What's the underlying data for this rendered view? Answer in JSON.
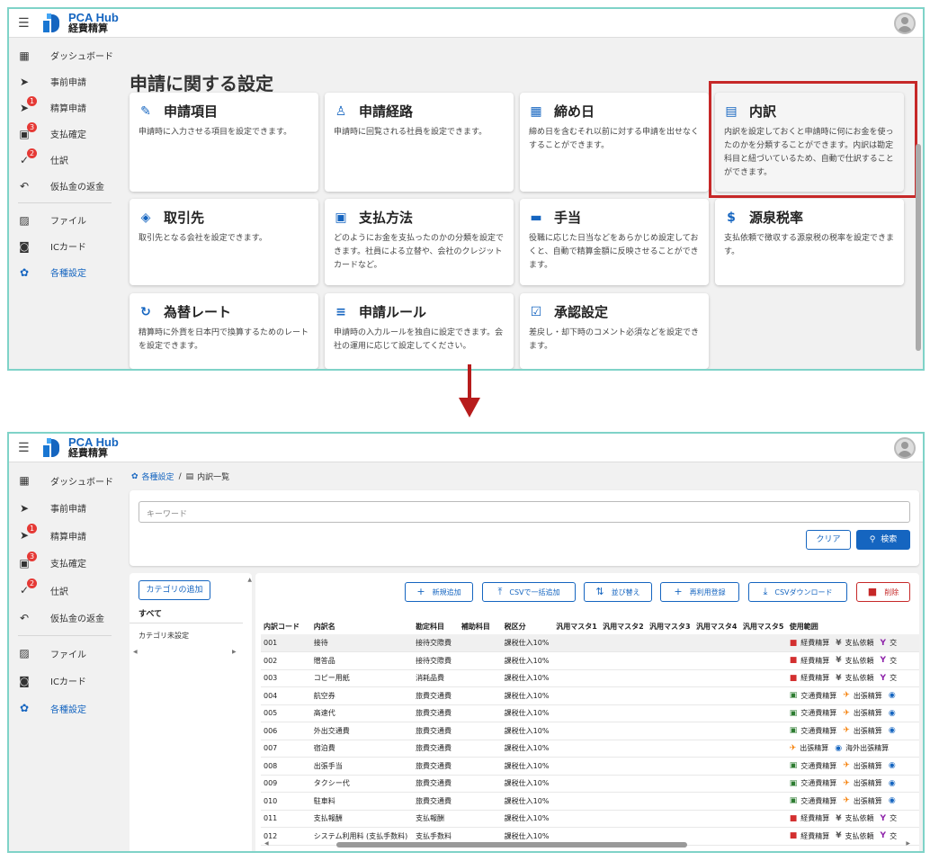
{
  "app": {
    "brand": "PCA Hub",
    "subtitle": "経費精算",
    "menu_icon": "☰"
  },
  "sidebar": {
    "items": [
      {
        "label": "ダッシュボード",
        "icon": "dashboard-icon",
        "glyph": "▦",
        "badge": ""
      },
      {
        "label": "事前申請",
        "icon": "send-clock-icon",
        "glyph": "➤",
        "badge": ""
      },
      {
        "label": "精算申請",
        "icon": "send-icon",
        "glyph": "➤",
        "badge": "1"
      },
      {
        "label": "支払確定",
        "icon": "payment-icon",
        "glyph": "▣",
        "badge": "3"
      },
      {
        "label": "仕訳",
        "icon": "check-icon",
        "glyph": "✓",
        "badge": "2"
      },
      {
        "label": "仮払金の返金",
        "icon": "undo-icon",
        "glyph": "↶",
        "badge": ""
      },
      {
        "label": "ファイル",
        "icon": "image-icon",
        "glyph": "▨",
        "badge": ""
      },
      {
        "label": "ICカード",
        "icon": "card-icon",
        "glyph": "◙",
        "badge": ""
      },
      {
        "label": "各種設定",
        "icon": "gear-icon",
        "glyph": "✿",
        "badge": ""
      }
    ]
  },
  "settings": {
    "title": "申請に関する設定",
    "cards": [
      {
        "title": "申請項目",
        "desc": "申請時に入力させる項目を設定できます。",
        "icon": "pencil-icon",
        "glyph": "✎"
      },
      {
        "title": "申請経路",
        "desc": "申請時に回覧される社員を設定できます。",
        "icon": "person-route-icon",
        "glyph": "♙"
      },
      {
        "title": "締め日",
        "desc": "締め日を含むそれ以前に対する申請を出せなくすることができます。",
        "icon": "calendar-icon",
        "glyph": "▦"
      },
      {
        "title": "内訳",
        "desc": "内訳を設定しておくと申請時に何にお金を使ったのかを分類することができます。内訳は勘定科目と紐づいているため、自動で仕訳することができます。",
        "icon": "receipt-icon",
        "glyph": "▤"
      },
      {
        "title": "取引先",
        "desc": "取引先となる会社を設定できます。",
        "icon": "handshake-icon",
        "glyph": "◈"
      },
      {
        "title": "支払方法",
        "desc": "どのようにお金を支払ったのかの分類を設定できます。社員による立替や、会社のクレジットカードなど。",
        "icon": "payment-method-icon",
        "glyph": "▣"
      },
      {
        "title": "手当",
        "desc": "役職に応じた日当などをあらかじめ設定しておくと、自動で精算金額に反映させることができます。",
        "icon": "bed-icon",
        "glyph": "▬"
      },
      {
        "title": "源泉税率",
        "desc": "支払依頼で徴収する源泉税の税率を設定できます。",
        "icon": "dollar-icon",
        "glyph": "$"
      },
      {
        "title": "為替レート",
        "desc": "精算時に外貨を日本円で換算するためのレートを設定できます。",
        "icon": "exchange-icon",
        "glyph": "↻"
      },
      {
        "title": "申請ルール",
        "desc": "申請時の入力ルールを独自に設定できます。会社の運用に応じて設定してください。",
        "icon": "rule-icon",
        "glyph": "≡"
      },
      {
        "title": "承認設定",
        "desc": "差戻し・却下時のコメント必須などを設定できます。",
        "icon": "approval-icon",
        "glyph": "☑"
      }
    ]
  },
  "breadcrumb": {
    "parent": "各種設定",
    "separator": "/",
    "current": "内訳一覧"
  },
  "search": {
    "placeholder": "キーワード",
    "clear_label": "クリア",
    "search_label": "検索"
  },
  "categories": {
    "add_label": "カテゴリの追加",
    "all_label": "すべて",
    "unset_label": "カテゴリ未設定"
  },
  "toolbar": {
    "new_label": "新規追加",
    "csv_import_label": "CSVで一括追加",
    "sort_label": "並び替え",
    "reuse_label": "再利用登録",
    "csv_download_label": "CSVダウンロード",
    "delete_label": "削除"
  },
  "table": {
    "headers": [
      "内訳コード",
      "内訳名",
      "勘定科目",
      "補助科目",
      "税区分",
      "汎用マスタ1",
      "汎用マスタ2",
      "汎用マスタ3",
      "汎用マスタ4",
      "汎用マスタ5",
      "使用範囲"
    ],
    "rows": [
      {
        "code": "001",
        "name": "接待",
        "account": "接待交際費",
        "sub": "",
        "tax": "課税仕入10%",
        "usage": [
          {
            "icon": "book-icon",
            "glyph": "■",
            "color": "#d32f2f",
            "label": "経費精算"
          },
          {
            "icon": "yen-icon",
            "glyph": "¥",
            "color": "#555555",
            "label": "支払依頼"
          },
          {
            "icon": "cocktail-icon",
            "glyph": "Y",
            "color": "#8e24aa",
            "label": "交"
          }
        ]
      },
      {
        "code": "002",
        "name": "贈答品",
        "account": "接待交際費",
        "sub": "",
        "tax": "課税仕入10%",
        "usage": [
          {
            "icon": "book-icon",
            "glyph": "■",
            "color": "#d32f2f",
            "label": "経費精算"
          },
          {
            "icon": "yen-icon",
            "glyph": "¥",
            "color": "#555555",
            "label": "支払依頼"
          },
          {
            "icon": "cocktail-icon",
            "glyph": "Y",
            "color": "#8e24aa",
            "label": "交"
          }
        ]
      },
      {
        "code": "003",
        "name": "コピー用紙",
        "account": "消耗品費",
        "sub": "",
        "tax": "課税仕入10%",
        "usage": [
          {
            "icon": "book-icon",
            "glyph": "■",
            "color": "#d32f2f",
            "label": "経費精算"
          },
          {
            "icon": "yen-icon",
            "glyph": "¥",
            "color": "#555555",
            "label": "支払依頼"
          },
          {
            "icon": "cocktail-icon",
            "glyph": "Y",
            "color": "#8e24aa",
            "label": "交"
          }
        ]
      },
      {
        "code": "004",
        "name": "航空券",
        "account": "旅費交通費",
        "sub": "",
        "tax": "課税仕入10%",
        "usage": [
          {
            "icon": "train-icon",
            "glyph": "▣",
            "color": "#2e7d32",
            "label": "交通費精算"
          },
          {
            "icon": "plane-icon",
            "glyph": "✈",
            "color": "#f57c00",
            "label": "出張精算"
          },
          {
            "icon": "globe-icon",
            "glyph": "◉",
            "color": "#1565c0",
            "label": ""
          }
        ]
      },
      {
        "code": "005",
        "name": "高速代",
        "account": "旅費交通費",
        "sub": "",
        "tax": "課税仕入10%",
        "usage": [
          {
            "icon": "train-icon",
            "glyph": "▣",
            "color": "#2e7d32",
            "label": "交通費精算"
          },
          {
            "icon": "plane-icon",
            "glyph": "✈",
            "color": "#f57c00",
            "label": "出張精算"
          },
          {
            "icon": "globe-icon",
            "glyph": "◉",
            "color": "#1565c0",
            "label": ""
          }
        ]
      },
      {
        "code": "006",
        "name": "外出交通費",
        "account": "旅費交通費",
        "sub": "",
        "tax": "課税仕入10%",
        "usage": [
          {
            "icon": "train-icon",
            "glyph": "▣",
            "color": "#2e7d32",
            "label": "交通費精算"
          },
          {
            "icon": "plane-icon",
            "glyph": "✈",
            "color": "#f57c00",
            "label": "出張精算"
          },
          {
            "icon": "globe-icon",
            "glyph": "◉",
            "color": "#1565c0",
            "label": ""
          }
        ]
      },
      {
        "code": "007",
        "name": "宿泊費",
        "account": "旅費交通費",
        "sub": "",
        "tax": "課税仕入10%",
        "usage": [
          {
            "icon": "plane-icon",
            "glyph": "✈",
            "color": "#f57c00",
            "label": "出張精算"
          },
          {
            "icon": "globe-icon",
            "glyph": "◉",
            "color": "#1565c0",
            "label": "海外出張精算"
          }
        ]
      },
      {
        "code": "008",
        "name": "出張手当",
        "account": "旅費交通費",
        "sub": "",
        "tax": "課税仕入10%",
        "usage": [
          {
            "icon": "train-icon",
            "glyph": "▣",
            "color": "#2e7d32",
            "label": "交通費精算"
          },
          {
            "icon": "plane-icon",
            "glyph": "✈",
            "color": "#f57c00",
            "label": "出張精算"
          },
          {
            "icon": "globe-icon",
            "glyph": "◉",
            "color": "#1565c0",
            "label": ""
          }
        ]
      },
      {
        "code": "009",
        "name": "タクシー代",
        "account": "旅費交通費",
        "sub": "",
        "tax": "課税仕入10%",
        "usage": [
          {
            "icon": "train-icon",
            "glyph": "▣",
            "color": "#2e7d32",
            "label": "交通費精算"
          },
          {
            "icon": "plane-icon",
            "glyph": "✈",
            "color": "#f57c00",
            "label": "出張精算"
          },
          {
            "icon": "globe-icon",
            "glyph": "◉",
            "color": "#1565c0",
            "label": ""
          }
        ]
      },
      {
        "code": "010",
        "name": "駐車料",
        "account": "旅費交通費",
        "sub": "",
        "tax": "課税仕入10%",
        "usage": [
          {
            "icon": "train-icon",
            "glyph": "▣",
            "color": "#2e7d32",
            "label": "交通費精算"
          },
          {
            "icon": "plane-icon",
            "glyph": "✈",
            "color": "#f57c00",
            "label": "出張精算"
          },
          {
            "icon": "globe-icon",
            "glyph": "◉",
            "color": "#1565c0",
            "label": ""
          }
        ]
      },
      {
        "code": "011",
        "name": "支払報酬",
        "account": "支払報酬",
        "sub": "",
        "tax": "課税仕入10%",
        "usage": [
          {
            "icon": "book-icon",
            "glyph": "■",
            "color": "#d32f2f",
            "label": "経費精算"
          },
          {
            "icon": "yen-icon",
            "glyph": "¥",
            "color": "#555555",
            "label": "支払依頼"
          },
          {
            "icon": "cocktail-icon",
            "glyph": "Y",
            "color": "#8e24aa",
            "label": "交"
          }
        ]
      },
      {
        "code": "012",
        "name": "システム利用料 (支払手数料)",
        "account": "支払手数料",
        "sub": "",
        "tax": "課税仕入10%",
        "usage": [
          {
            "icon": "book-icon",
            "glyph": "■",
            "color": "#d32f2f",
            "label": "経費精算"
          },
          {
            "icon": "yen-icon",
            "glyph": "¥",
            "color": "#555555",
            "label": "支払依頼"
          },
          {
            "icon": "cocktail-icon",
            "glyph": "Y",
            "color": "#8e24aa",
            "label": "交"
          }
        ]
      }
    ]
  },
  "colors": {
    "accent": "#1565c0",
    "highlight": "#c62828",
    "frame": "#7fd3c8"
  }
}
